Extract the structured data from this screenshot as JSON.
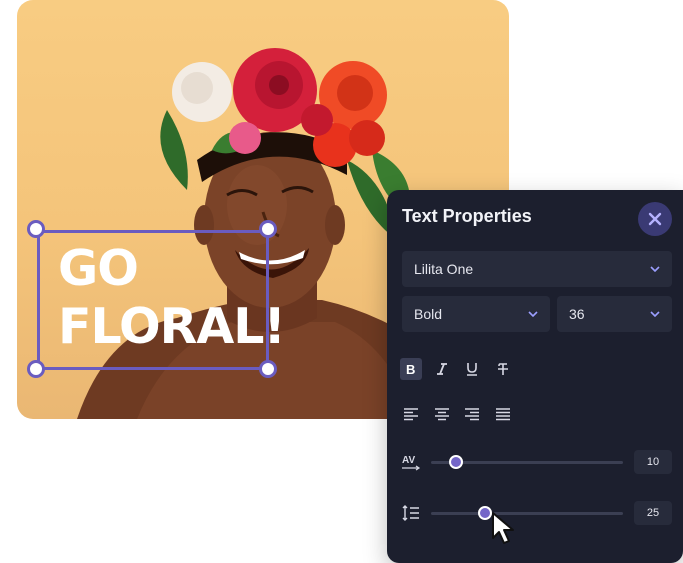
{
  "canvas": {
    "overlay_text": "GO\nFLORAL!"
  },
  "panel": {
    "title": "Text Properties",
    "font_family": "Lilita One",
    "font_weight": "Bold",
    "font_size": "36",
    "style_buttons": [
      "bold-icon",
      "italic-icon",
      "underline-icon",
      "strikethrough-icon"
    ],
    "active_style": "bold",
    "align_buttons": [
      "align-left-icon",
      "align-center-icon",
      "align-right-icon",
      "align-justify-icon"
    ],
    "letter_spacing": {
      "value": "10",
      "icon": "letter-spacing-icon"
    },
    "line_height": {
      "value": "25",
      "icon": "line-height-icon"
    }
  },
  "colors": {
    "accent": "#6a5cc0",
    "panel_bg": "#1c1f2e",
    "field_bg": "#272b3b",
    "photo_bg": "#f6c87f"
  }
}
